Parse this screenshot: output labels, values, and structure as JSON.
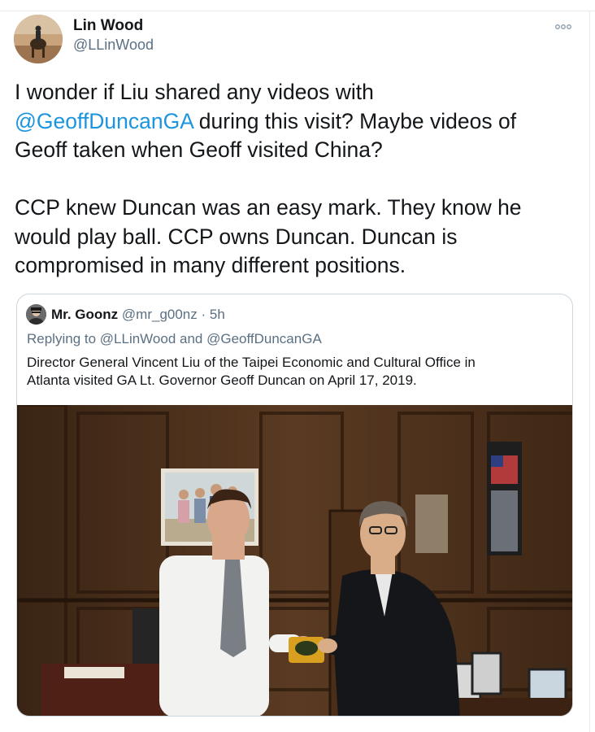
{
  "author": {
    "name": "Lin Wood",
    "handle": "@LLinWood"
  },
  "tweet": {
    "line1": "I wonder if Liu shared any videos with",
    "line2_mention": "@GeoffDuncanGA",
    "line2_rest": " during this visit? Maybe videos of",
    "line3": "Geoff taken when Geoff visited China?",
    "line4": "CCP knew Duncan was an easy mark. They know he",
    "line5": "would play ball. CCP owns Duncan. Duncan is",
    "line6": "compromised in many different positions."
  },
  "quote": {
    "name": "Mr. Goonz",
    "handle": "@mr_g00nz",
    "separator": " · ",
    "time": "5h",
    "replying_prefix": "Replying to ",
    "replying_user1": "@LLinWood",
    "replying_and": " and ",
    "replying_user2": "@GeoffDuncanGA",
    "text_line1": "Director General Vincent Liu of the Taipei Economic and Cultural Office in",
    "text_line2": "Atlanta visited GA Lt. Governor Geoff Duncan on April 17, 2019."
  },
  "icons": {
    "more": "more-options-icon"
  },
  "colors": {
    "mention": "#1b95e0",
    "secondary_text": "#5b7083",
    "border": "#ccd6dd"
  }
}
